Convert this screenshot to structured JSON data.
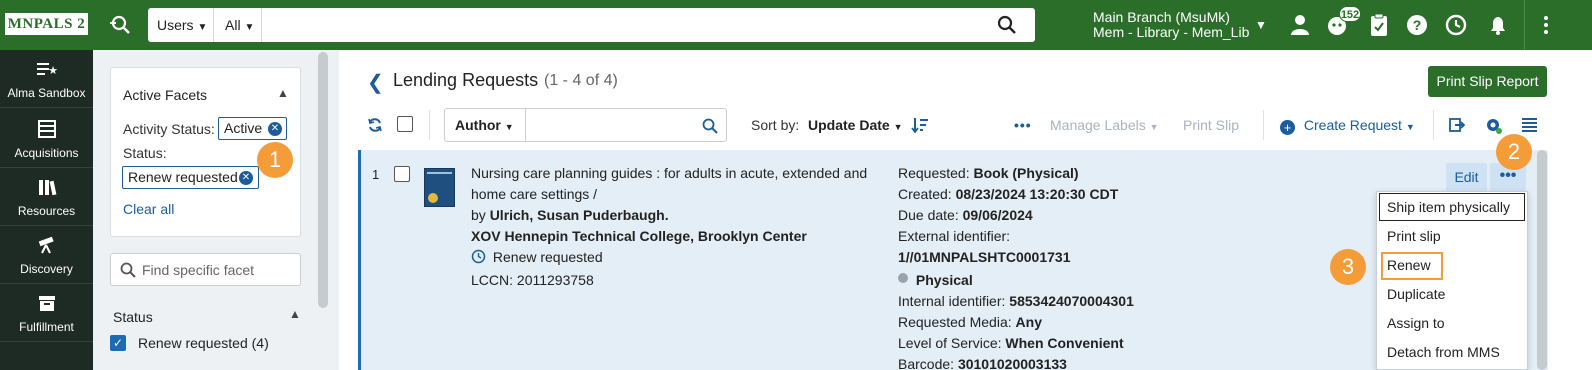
{
  "app": {
    "logo": "MNPALS 2"
  },
  "search": {
    "entity": "Users",
    "scope": "All",
    "value": "",
    "placeholder": ""
  },
  "location": {
    "line1": "Main Branch (MsuMk)",
    "line2": "Mem - Library - Mem_Lib"
  },
  "notifications": {
    "count": "152"
  },
  "icons": [
    "person-add-icon",
    "search-icon",
    "user-icon",
    "notification-icon",
    "clipboard-icon",
    "help-icon",
    "history-icon",
    "bell-icon",
    "kebab-icon"
  ],
  "leftnav": [
    {
      "label": "Alma Sandbox",
      "icon": "sandbox-icon"
    },
    {
      "label": "Acquisitions",
      "icon": "acquisitions-icon"
    },
    {
      "label": "Resources",
      "icon": "resources-icon"
    },
    {
      "label": "Discovery",
      "icon": "discovery-icon"
    },
    {
      "label": "Fulfillment",
      "icon": "fulfillment-icon"
    }
  ],
  "facets": {
    "active_title": "Active Facets",
    "activity_label": "Activity Status:",
    "activity_value": "Active",
    "status_label": "Status:",
    "status_value": "Renew requested",
    "clear_all": "Clear all",
    "search_placeholder": "Find specific facet",
    "status_section": "Status",
    "status_option": "Renew requested",
    "status_option_count": "(4)"
  },
  "page": {
    "title": "Lending Requests",
    "count": "(1 - 4 of 4)",
    "print_report": "Print Slip Report"
  },
  "toolbar": {
    "author": "Author",
    "author_value": "",
    "sort_label": "Sort by:",
    "sort_value": "Update Date",
    "manage_labels": "Manage Labels",
    "print_slip": "Print Slip",
    "create_request": "Create Request"
  },
  "record": {
    "index": "1",
    "title_line1": "Nursing care planning guides : for adults in acute, extended and",
    "title_line2": "home care settings /",
    "by_prefix": "by",
    "author": "Ulrich, Susan Puderbaugh.",
    "partner": "XOV Hennepin Technical College, Brooklyn Center",
    "status": "Renew requested",
    "lccn_label": "LCCN:",
    "lccn": "2011293758",
    "requested_label": "Requested:",
    "requested": "Book (Physical)",
    "created_label": "Created:",
    "created": "08/23/2024 13:20:30 CDT",
    "due_label": "Due date:",
    "due": "09/06/2024",
    "external_label": "External identifier:",
    "external": "1//01MNPALSHTC0001731",
    "format": "Physical",
    "internal_label": "Internal identifier:",
    "internal": "5853424070004301",
    "media_label": "Requested Media:",
    "media": "Any",
    "service_label": "Level of Service:",
    "service": "When Convenient",
    "barcode_label": "Barcode:",
    "barcode": "30101020003133"
  },
  "row_actions": {
    "edit": "Edit",
    "more": "•••"
  },
  "menu": [
    "Ship item physically",
    "Print slip",
    "Renew",
    "Duplicate",
    "Assign to",
    "Detach from MMS"
  ],
  "callouts": [
    "1",
    "2",
    "3"
  ],
  "colors": {
    "brand_green": "#2a6e2a",
    "accent_blue": "#1c5c9a",
    "callout_orange": "#f39c38",
    "nav_dark": "#1e2a24"
  }
}
